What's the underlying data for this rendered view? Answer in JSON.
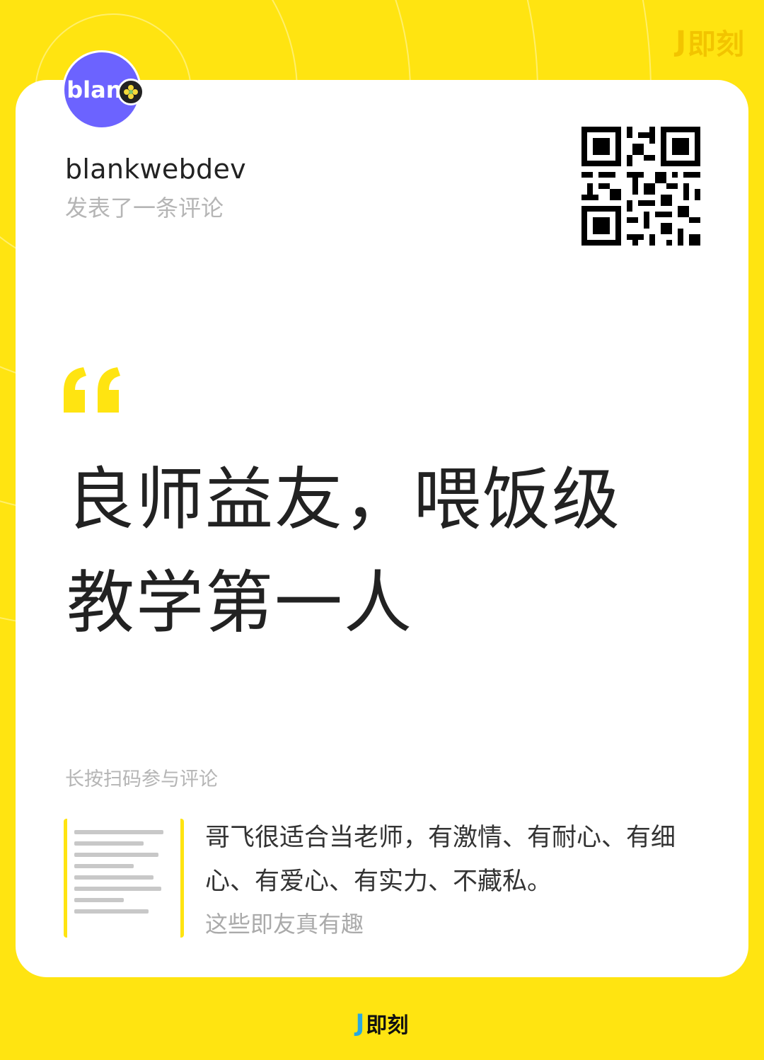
{
  "brand": {
    "name": "即刻",
    "logo_mark": "J"
  },
  "author": {
    "avatar_text": "blank",
    "username": "blankwebdev",
    "action": "发表了一条评论"
  },
  "comment": {
    "lines": [
      "良师益友，喂饭级",
      "教学第一人"
    ]
  },
  "hint": "长按扫码参与评论",
  "original": {
    "text": "哥飞很适合当老师，有激情、有耐心、有细心、有爱心、有实力、不藏私。",
    "topic": "这些即友真有趣"
  },
  "colors": {
    "background": "#FFE411",
    "avatar": "#6C63FF",
    "quote_mark": "#FFE411",
    "logo_accent": "#27A8E0"
  }
}
